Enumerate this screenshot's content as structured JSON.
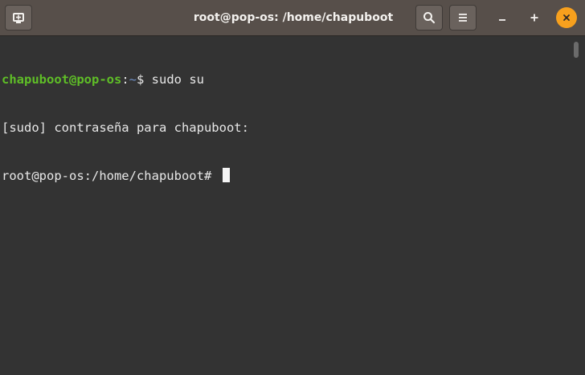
{
  "window": {
    "title": "root@pop-os: /home/chapuboot"
  },
  "terminal": {
    "line1": {
      "user_host": "chapuboot@pop-os",
      "separator": ":",
      "path": "~",
      "prompt": "$",
      "command": " sudo su"
    },
    "line2": "[sudo] contraseña para chapuboot:",
    "line3": "root@pop-os:/home/chapuboot# "
  },
  "icons": {
    "new_tab": "new-tab-icon",
    "search": "search-icon",
    "menu": "hamburger-menu-icon",
    "minimize": "minimize-icon",
    "maximize": "maximize-icon",
    "close": "close-icon"
  },
  "colors": {
    "titlebar": "#574f4a",
    "terminal_bg": "#333333",
    "prompt_user": "#5fbe27",
    "prompt_path": "#6f90c8",
    "close_accent": "#f7a01d"
  }
}
